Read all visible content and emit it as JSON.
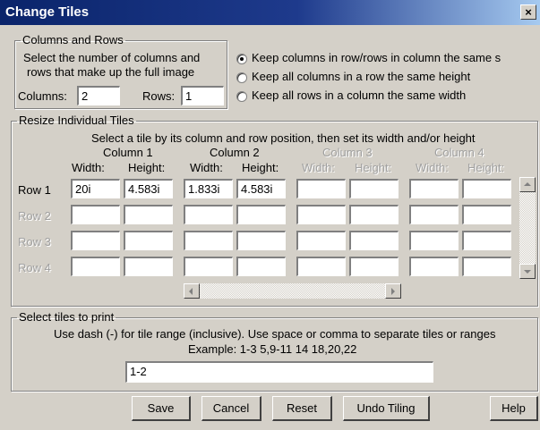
{
  "window": {
    "title": "Change Tiles",
    "close_glyph": "×"
  },
  "columns_rows": {
    "legend": "Columns and Rows",
    "instructions": [
      "Select the number of columns and",
      "rows that make up the full image"
    ],
    "columns_label": "Columns:",
    "columns_value": "2",
    "rows_label": "Rows:",
    "rows_value": "1",
    "options": [
      {
        "label": "Keep columns in row/rows in column the same s",
        "checked": true
      },
      {
        "label": "Keep all columns in a row the same height",
        "checked": false
      },
      {
        "label": "Keep all rows in a column the same width",
        "checked": false
      }
    ]
  },
  "resize": {
    "legend": "Resize Individual Tiles",
    "instruction": "Select a tile by its column and row position, then set its width and/or height",
    "columns": [
      {
        "label": "Column 1",
        "enabled": true
      },
      {
        "label": "Column 2",
        "enabled": true
      },
      {
        "label": "Column 3",
        "enabled": false
      },
      {
        "label": "Column 4",
        "enabled": false
      }
    ],
    "width_label": "Width:",
    "height_label": "Height:",
    "rows": [
      {
        "label": "Row 1",
        "enabled": true,
        "cells": [
          "20i",
          "4.583i",
          "1.833i",
          "4.583i",
          "",
          "",
          "",
          ""
        ]
      },
      {
        "label": "Row 2",
        "enabled": false,
        "cells": [
          "",
          "",
          "",
          "",
          "",
          "",
          "",
          ""
        ]
      },
      {
        "label": "Row 3",
        "enabled": false,
        "cells": [
          "",
          "",
          "",
          "",
          "",
          "",
          "",
          ""
        ]
      },
      {
        "label": "Row 4",
        "enabled": false,
        "cells": [
          "",
          "",
          "",
          "",
          "",
          "",
          "",
          ""
        ]
      }
    ]
  },
  "print": {
    "legend": "Select tiles to print",
    "instruction": "Use dash (-) for tile range (inclusive). Use space or comma to separate tiles or ranges",
    "example": "Example: 1-3 5,9-11 14 18,20,22",
    "value": "1-2"
  },
  "buttons": {
    "save": "Save",
    "cancel": "Cancel",
    "reset": "Reset",
    "undo_tiling": "Undo Tiling",
    "help": "Help"
  }
}
